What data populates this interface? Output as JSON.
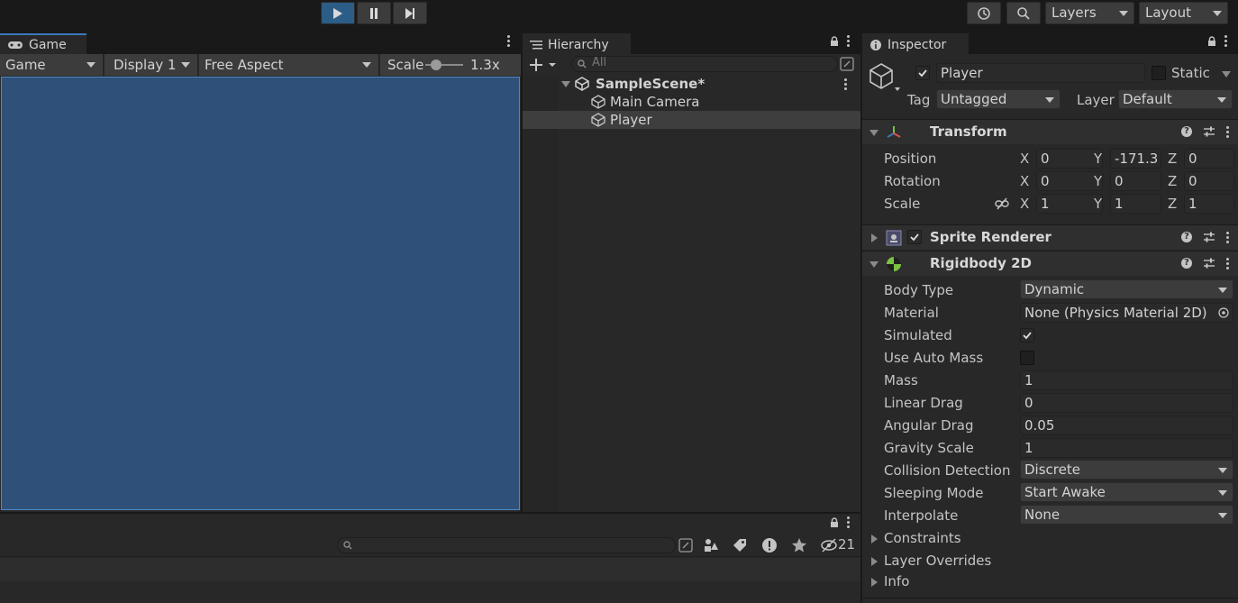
{
  "toolbar": {
    "play_icon": "play-icon",
    "pause_icon": "pause-icon",
    "step_icon": "step-icon",
    "history_icon": "history-icon",
    "search_icon": "search-icon",
    "layers_label": "Layers",
    "layout_label": "Layout",
    "accent": "#2c5d87"
  },
  "game": {
    "tab_label": "Game",
    "view_select": "Game",
    "display_select": "Display 1",
    "aspect_select": "Free Aspect",
    "scale_label": "Scale",
    "scale_value": "1.3x",
    "background_color": "#2f5079"
  },
  "hierarchy": {
    "tab_label": "Hierarchy",
    "search_placeholder": "All",
    "scene_name": "SampleScene*",
    "items": [
      {
        "label": "Main Camera",
        "selected": false
      },
      {
        "label": "Player",
        "selected": true
      }
    ]
  },
  "console": {
    "search_placeholder": "",
    "hidden_count": "21"
  },
  "inspector": {
    "tab_label": "Inspector",
    "object_name": "Player",
    "active": true,
    "static_label": "Static",
    "static_checked": false,
    "tag_label": "Tag",
    "tag_value": "Untagged",
    "layer_label": "Layer",
    "layer_value": "Default",
    "transform": {
      "title": "Transform",
      "position_label": "Position",
      "rotation_label": "Rotation",
      "scale_label": "Scale",
      "position": {
        "x": "0",
        "y": "-171.3",
        "z": "0"
      },
      "rotation": {
        "x": "0",
        "y": "0",
        "z": "0"
      },
      "scale": {
        "x": "1",
        "y": "1",
        "z": "1"
      },
      "axes": {
        "x": "X",
        "y": "Y",
        "z": "Z"
      }
    },
    "sprite_renderer": {
      "title": "Sprite Renderer",
      "enabled": true
    },
    "rigidbody": {
      "title": "Rigidbody 2D",
      "body_type_label": "Body Type",
      "body_type": "Dynamic",
      "material_label": "Material",
      "material": "None (Physics Material 2D)",
      "simulated_label": "Simulated",
      "simulated": true,
      "use_auto_mass_label": "Use Auto Mass",
      "use_auto_mass": false,
      "mass_label": "Mass",
      "mass": "1",
      "linear_drag_label": "Linear Drag",
      "linear_drag": "0",
      "angular_drag_label": "Angular Drag",
      "angular_drag": "0.05",
      "gravity_scale_label": "Gravity Scale",
      "gravity_scale": "1",
      "collision_detection_label": "Collision Detection",
      "collision_detection": "Discrete",
      "sleeping_mode_label": "Sleeping Mode",
      "sleeping_mode": "Start Awake",
      "interpolate_label": "Interpolate",
      "interpolate": "None",
      "constraints_label": "Constraints",
      "layer_overrides_label": "Layer Overrides",
      "info_label": "Info"
    }
  }
}
